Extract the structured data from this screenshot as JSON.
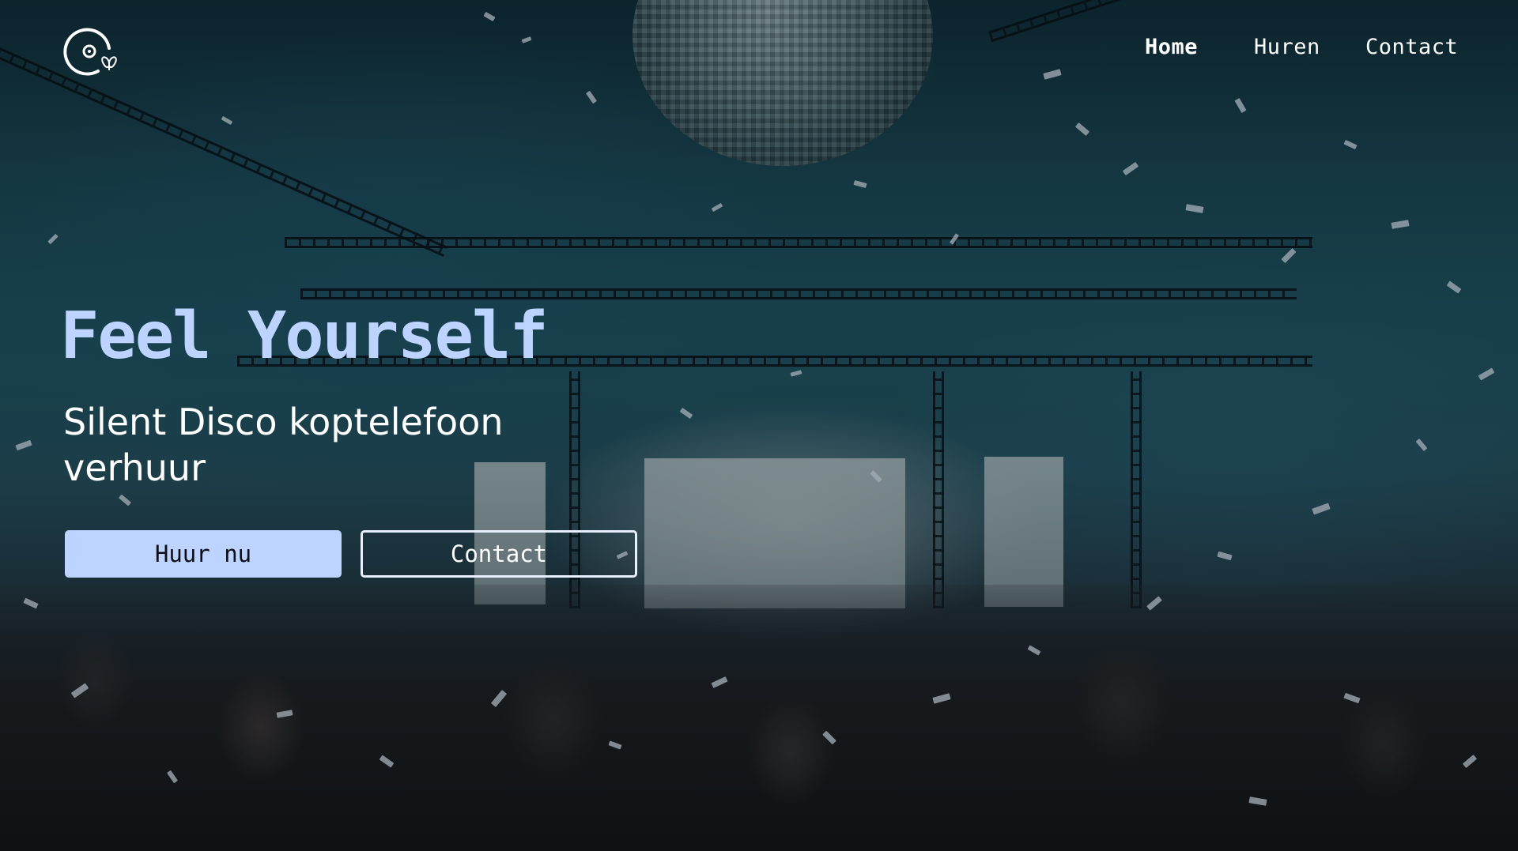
{
  "nav": {
    "items": [
      {
        "label": "Home",
        "active": true
      },
      {
        "label": "Huren",
        "active": false
      },
      {
        "label": "Contact",
        "active": false
      }
    ]
  },
  "hero": {
    "title": "Feel Yourself",
    "subtitle": "Silent Disco koptelefoon verhuur",
    "primary_button": "Huur nu",
    "secondary_button": "Contact"
  },
  "icons": {
    "logo": "disc-butterfly-logo-icon"
  },
  "colors": {
    "accent": "#bcd4ff",
    "text": "#ffffff"
  }
}
